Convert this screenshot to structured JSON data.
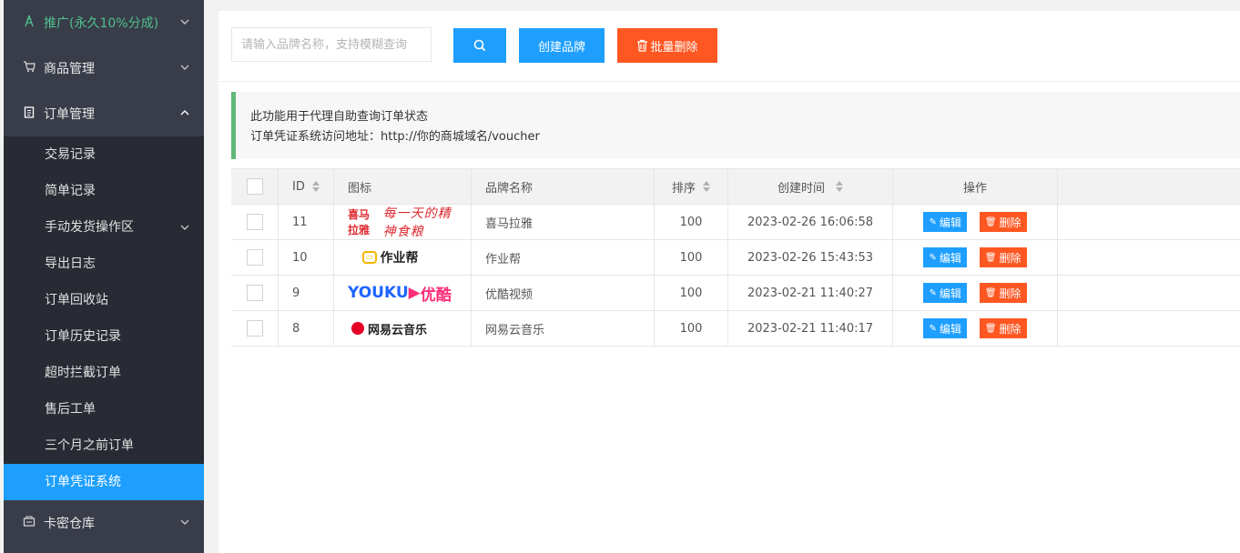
{
  "sidebar": {
    "top_items": [
      {
        "label": "推广(永久10%分成)",
        "icon": "share-icon"
      },
      {
        "label": "商品管理",
        "icon": "cart-icon"
      },
      {
        "label": "订单管理",
        "icon": "clipboard-icon"
      }
    ],
    "order_submenu": [
      {
        "label": "交易记录"
      },
      {
        "label": "简单记录"
      },
      {
        "label": "手动发货操作区"
      },
      {
        "label": "导出日志"
      },
      {
        "label": "订单回收站"
      },
      {
        "label": "订单历史记录"
      },
      {
        "label": "超时拦截订单"
      },
      {
        "label": "售后工单"
      },
      {
        "label": "三个月之前订单"
      },
      {
        "label": "订单凭证系统"
      }
    ],
    "bottom_items": [
      {
        "label": "卡密仓库",
        "icon": "storage-icon"
      }
    ],
    "active_item": "订单凭证系统",
    "active_color": "#1e9fff"
  },
  "toolbar": {
    "search_placeholder": "请输入品牌名称，支持模糊查询",
    "search_icon": "search-icon",
    "create_label": "创建品牌",
    "batch_delete_label": "批量删除",
    "batch_delete_icon": "trash-icon"
  },
  "notice": {
    "line1": "此功能用于代理自助查询订单状态",
    "line2": "订单凭证系统访问地址：http://你的商城域名/voucher"
  },
  "table": {
    "headers": {
      "id": "ID",
      "icon": "图标",
      "name": "品牌名称",
      "sort": "排序",
      "created": "创建时间",
      "actions": "操作"
    },
    "edit_label": "编辑",
    "delete_label": "删除",
    "rows": [
      {
        "id": "11",
        "logo_main": "喜马拉雅",
        "logo_sub": "每一天的精神食粮",
        "name": "喜马拉雅",
        "sort": "100",
        "created": "2023-02-26 16:06:58"
      },
      {
        "id": "10",
        "logo_main": "作业帮",
        "logo_sub": "",
        "name": "作业帮",
        "sort": "100",
        "created": "2023-02-26 15:43:53"
      },
      {
        "id": "9",
        "logo_main": "YOUKU",
        "logo_sub": "优酷",
        "name": "优酷视频",
        "sort": "100",
        "created": "2023-02-21 11:40:27"
      },
      {
        "id": "8",
        "logo_main": "网易云音乐",
        "logo_sub": "",
        "name": "网易云音乐",
        "sort": "100",
        "created": "2023-02-21 11:40:17"
      }
    ]
  },
  "colors": {
    "primary": "#1e9fff",
    "danger": "#ff5722",
    "sidebar_bg": "#393d49",
    "notice_border": "#5fb878",
    "promo_text": "#4fc08d"
  }
}
